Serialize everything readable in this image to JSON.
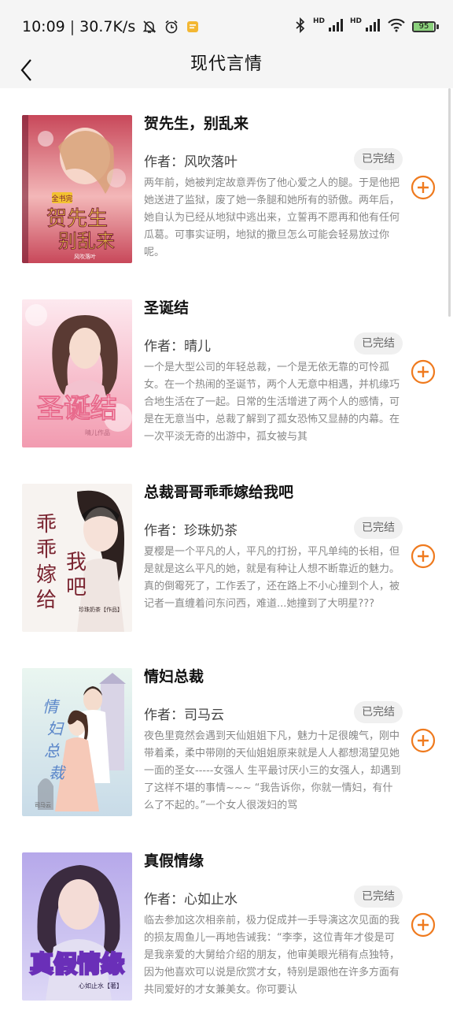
{
  "status_bar": {
    "time": "10:09",
    "speed": "30.7K/s",
    "hd1": "HD",
    "hd2": "HD",
    "battery": "95",
    "battery_level": 0.95
  },
  "header": {
    "title": "现代言情",
    "back_icon": "chevron-left-icon"
  },
  "books": [
    {
      "title": "贺先生，别乱来",
      "author": "作者：风吹落叶",
      "status": "已完结",
      "intro": "两年前，她被判定故意弄伤了他心爱之人的腿。于是他把她送进了监狱，废了她一条腿和她所有的骄傲。两年后，她自认为已经从地狱中逃出来，立誓再不愿再和他有任何瓜葛。可事实证明，地狱的撒旦怎么可能会轻易放过你呢。",
      "cover_text": "贺先生别乱来",
      "cover_sub": "风吹落叶",
      "cover_badge": "全书完",
      "cover_colors": [
        "#c8485a",
        "#f3b7b8",
        "#7a1f35"
      ]
    },
    {
      "title": "圣诞结",
      "author": "作者：晴儿",
      "status": "已完结",
      "intro": "一个是大型公司的年轻总裁，一个是无依无靠的可怜孤女。在一个热闹的圣诞节，两个人无意中相遇，并机缘巧合地生活在了一起。日常的生活增进了两个人的感情，可是在无意当中，总裁了解到了孤女恐怖又显赫的内幕。在一次平淡无奇的出游中，孤女被与其",
      "cover_text": "圣诞结",
      "cover_sub": "晴儿作品",
      "cover_colors": [
        "#fbe3ea",
        "#f29bb0",
        "#e86a8c"
      ]
    },
    {
      "title": "总裁哥哥乖乖嫁给我吧",
      "author": "作者：珍珠奶茶",
      "status": "已完结",
      "intro": "夏樱是一个平凡的人，平凡的打扮，平凡单纯的长相，但是就是这么平凡的她，就是有种让人想不断靠近的魅力。真的倒霉死了，工作丢了，还在路上不小心撞到个人，被记者一直缠着问东问西，难道...她撞到了大明星???",
      "cover_text": "乖乖嫁给我吧",
      "cover_sub": "珍珠奶茶【作品】",
      "cover_colors": [
        "#f7f3f0",
        "#e9d9d2",
        "#7a2430"
      ]
    },
    {
      "title": "情妇总裁",
      "author": "作者：司马云",
      "status": "已完结",
      "intro": "夜色里竟然会遇到天仙姐姐下凡，魅力十足很魄气，刚中带着柔，柔中带刚的天仙姐姐原来就是人人都想渴望见她一面的圣女-----女强人 生平最讨厌小三的女强人，却遇到了这样不堪的事情~~~ “我告诉你，你就一情妇，有什么了不起的。”一个女人很泼妇的骂",
      "cover_text": "情妇总裁",
      "cover_sub": "司马云",
      "cover_colors": [
        "#dff1ea",
        "#b7d9e8",
        "#5a86c9"
      ]
    },
    {
      "title": "真假情缘",
      "author": "作者：心如止水",
      "status": "已完结",
      "intro": "临去参加这次相亲前，极力促成并一手导演这次见面的我的损友周鱼儿一再地告诫我：“李李，这位青年才俊是可是我亲爱的大舅给介绍的朋友，他审美眼光稍有点独特，因为他喜欢可以说是欣赏才女，特别是跟他在许多方面有共同爱好的才女兼美女。你可要认",
      "cover_text": "真假情缘",
      "cover_sub": "心如止水【著】",
      "cover_colors": [
        "#c9c2ef",
        "#9c8be0",
        "#6a2fb8"
      ]
    }
  ]
}
